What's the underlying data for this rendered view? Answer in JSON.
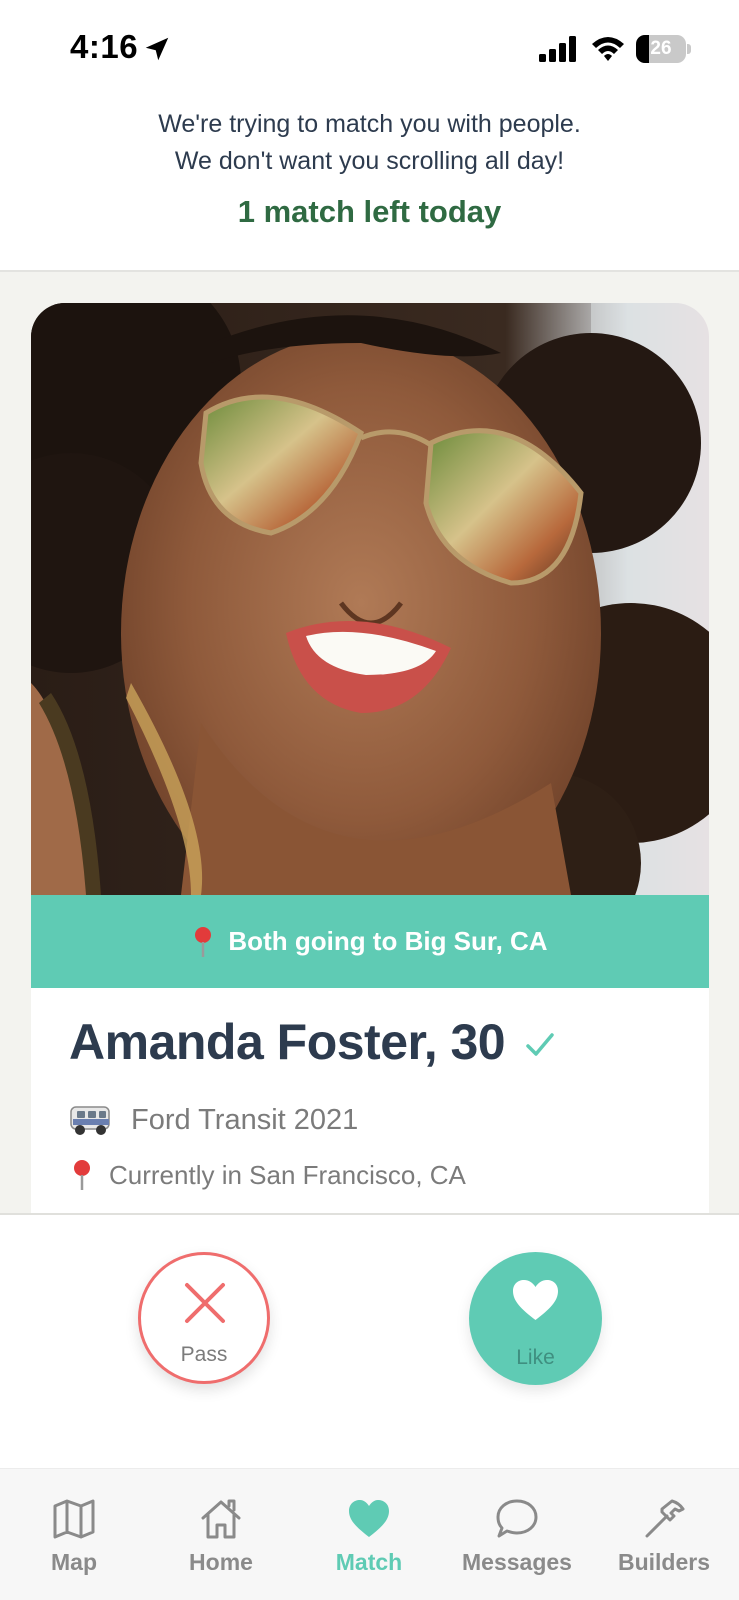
{
  "status_bar": {
    "time": "4:16",
    "battery": "26",
    "battery_level": 0.26,
    "icons": [
      "location-arrow-icon",
      "signal-icon",
      "wifi-icon",
      "battery-icon"
    ]
  },
  "header": {
    "line1": "We're trying to match you with people.",
    "line2": "We don't want you scrolling all day!",
    "matches_left": "1 match left today"
  },
  "profile": {
    "trip_text": "Both going to Big Sur, CA",
    "name_age": "Amanda Foster, 30",
    "vehicle": "Ford Transit 2021",
    "current_location": "Currently in San Francisco, CA"
  },
  "actions": {
    "pass_label": "Pass",
    "like_label": "Like"
  },
  "tabs": [
    {
      "label": "Map",
      "icon": "map-icon",
      "active": false
    },
    {
      "label": "Home",
      "icon": "home-icon",
      "active": false
    },
    {
      "label": "Match",
      "icon": "heart-icon",
      "active": true
    },
    {
      "label": "Messages",
      "icon": "chat-bubble-icon",
      "active": false
    },
    {
      "label": "Builders",
      "icon": "hammer-icon",
      "active": false
    }
  ],
  "colors": {
    "accent": "#5fcbb4",
    "pass_red": "#ef6d6d",
    "headline_green": "#2f6a42",
    "text_dark": "#2d3b4e"
  }
}
